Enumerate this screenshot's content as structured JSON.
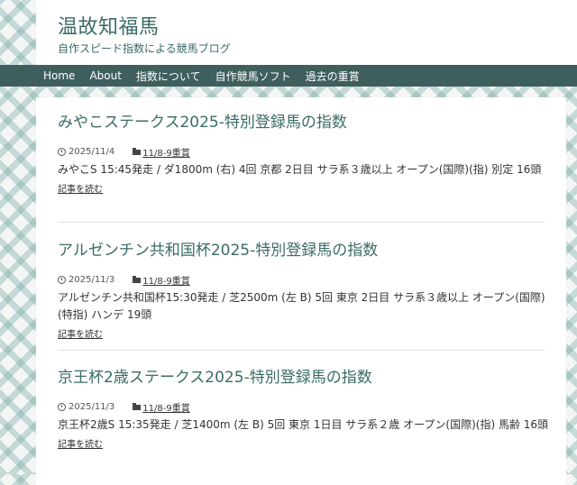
{
  "site": {
    "title": "温故知福馬",
    "description": "自作スピード指数による競馬ブログ"
  },
  "nav": [
    "Home",
    "About",
    "指数について",
    "自作競馬ソフト",
    "過去の重賞"
  ],
  "colors": {
    "accent": "#3b6b68",
    "nav_bg": "#3e5f5d"
  },
  "posts": [
    {
      "title": "みやこステークス2025-特別登録馬の指数",
      "date": "2025/11/4",
      "category": "11/8-9重賞",
      "excerpt": "みやこS 15:45発走 / ダ1800m (右) 4回 京都 2日目 サラ系３歳以上 オープン(国際)(指) 別定 16頭",
      "more": "記事を読む"
    },
    {
      "title": "アルゼンチン共和国杯2025-特別登録馬の指数",
      "date": "2025/11/3",
      "category": "11/8-9重賞",
      "excerpt": "アルゼンチン共和国杯15:30発走 / 芝2500m (左 B) 5回 東京 2日目 サラ系３歳以上 オープン(国際)(特指) ハンデ 19頭",
      "more": "記事を読む"
    },
    {
      "title": "京王杯2歳ステークス2025-特別登録馬の指数",
      "date": "2025/11/3",
      "category": "11/8-9重賞",
      "excerpt": "京王杯2歳S 15:35発走 / 芝1400m (左 B) 5回 東京 1日目 サラ系２歳 オープン(国際)(指) 馬齢 16頭",
      "more": "記事を読む"
    }
  ]
}
